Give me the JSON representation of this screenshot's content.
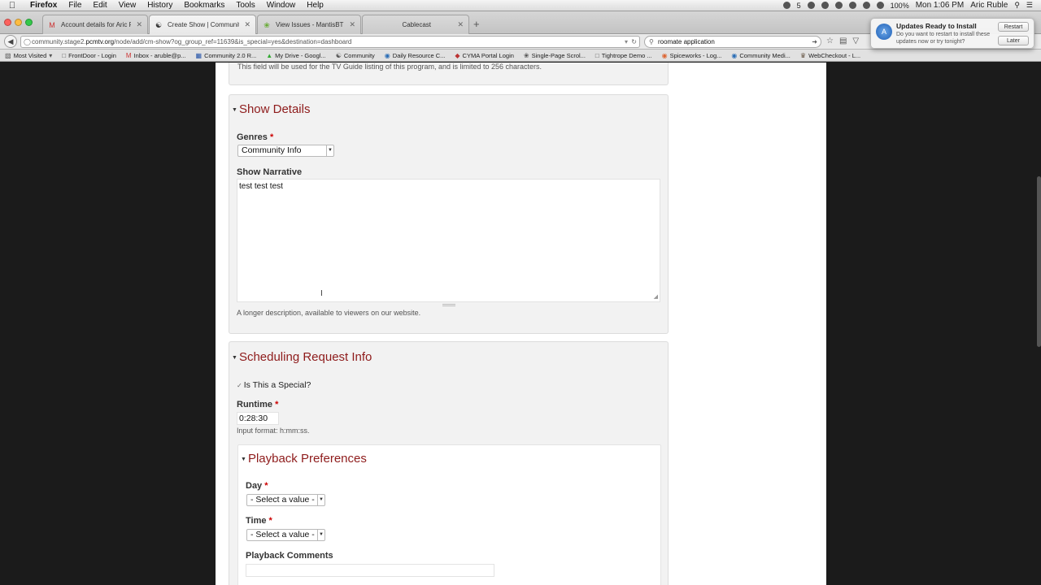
{
  "menubar": {
    "app": "Firefox",
    "items": [
      "File",
      "Edit",
      "View",
      "History",
      "Bookmarks",
      "Tools",
      "Window",
      "Help"
    ],
    "battery": "100%",
    "clock": "Mon 1:06 PM",
    "user": "Aric Ruble",
    "badge": "5"
  },
  "tabs": [
    {
      "title": "Account details for Aric R..."
    },
    {
      "title": "Create Show | Community"
    },
    {
      "title": "View Issues - MantisBT"
    },
    {
      "title": "Cablecast"
    }
  ],
  "nav": {
    "url_host": "community.stage2.",
    "url_domain": "pcmtv.org",
    "url_path": "/node/add/cm-show?og_group_ref=11639&is_special=yes&destination=dashboard",
    "search": "roomate application"
  },
  "notification": {
    "title": "Updates Ready to Install",
    "text": "Do you want to restart to install these updates now or try tonight?",
    "restart": "Restart",
    "later": "Later"
  },
  "bookmarks": [
    "Most Visited",
    "FrontDoor - Login",
    "Inbox - aruble@p...",
    "Community 2.0 R...",
    "My Drive - Googl...",
    "Community",
    "Daily Resource C...",
    "CYMA Portal Login",
    "Single-Page Scrol...",
    "Tightrope Demo ...",
    "Spiceworks - Log...",
    "Community Medi...",
    "WebCheckout - L..."
  ],
  "page": {
    "tv_guide_desc": "This field will be used for the TV Guide listing of this program, and is limited to 256 characters.",
    "show_details": {
      "legend": "Show Details",
      "genres_label": "Genres",
      "genres_value": "Community Info",
      "narrative_label": "Show Narrative",
      "narrative_value": "test test test",
      "narrative_desc": "A longer description, available to viewers on our website."
    },
    "scheduling": {
      "legend": "Scheduling Request Info",
      "special_label": "Is This a Special?",
      "runtime_label": "Runtime",
      "runtime_value": "0:28:30",
      "runtime_desc": "Input format: h:mm:ss.",
      "playback": {
        "legend": "Playback Preferences",
        "day_label": "Day",
        "day_value": "- Select a value -",
        "time_label": "Time",
        "time_value": "- Select a value -",
        "comments_label": "Playback Comments"
      }
    },
    "required_mark": "*"
  }
}
